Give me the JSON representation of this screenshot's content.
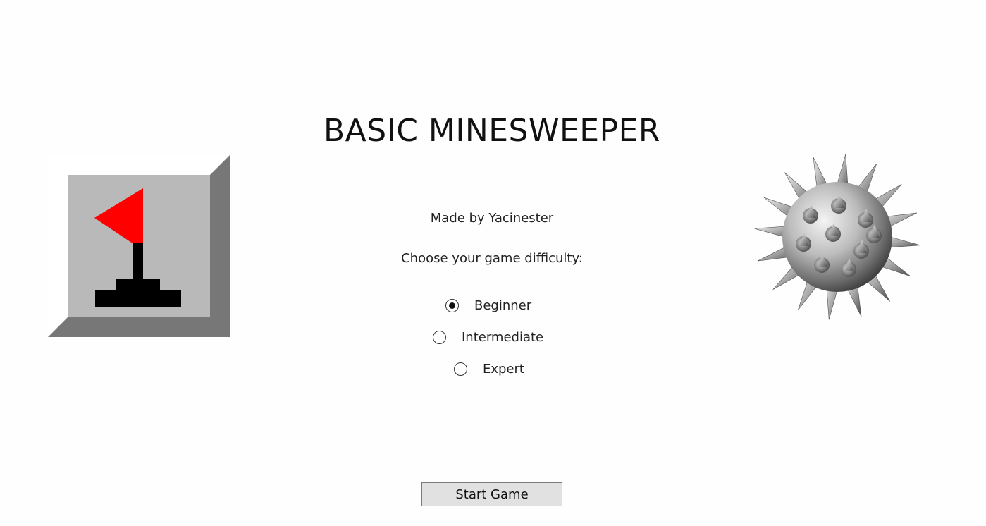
{
  "app": {
    "title": "BASIC MINESWEEPER",
    "credit": "Made by Yacinester",
    "prompt": "Choose your game difficulty:"
  },
  "difficulty": {
    "options": [
      {
        "label": "Beginner",
        "selected": true
      },
      {
        "label": "Intermediate",
        "selected": false
      },
      {
        "label": "Expert",
        "selected": false
      }
    ]
  },
  "actions": {
    "start_label": "Start Game"
  },
  "images": {
    "left": "flag-tile-icon",
    "right": "mine-icon"
  },
  "colors": {
    "flag": "#ff0000",
    "tile_face": "#b9b9b9",
    "tile_shadow": "#777777",
    "tile_highlight": "#ffffff",
    "button_bg": "#e1e1e1"
  }
}
